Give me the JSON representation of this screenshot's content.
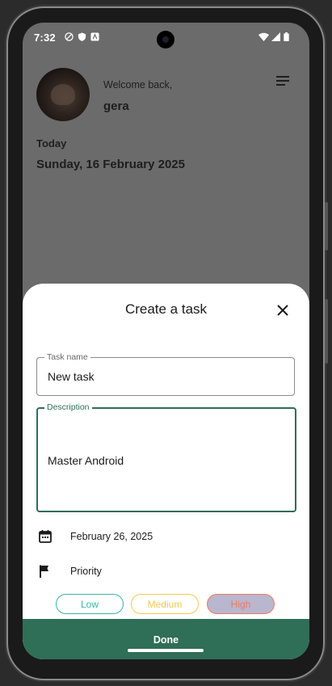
{
  "status_bar": {
    "time": "7:32"
  },
  "header": {
    "welcome": "Welcome back,",
    "username": "gera",
    "today_label": "Today",
    "full_date": "Sunday, 16 February 2025"
  },
  "sheet": {
    "title": "Create a task",
    "task_name": {
      "label": "Task name",
      "value": "New task"
    },
    "description": {
      "label": "Description",
      "value": "Master Android"
    },
    "due_date": "February 26, 2025",
    "priority_label": "Priority",
    "priorities": [
      {
        "label": "Low",
        "color": "#3fb3a4"
      },
      {
        "label": "Medium",
        "color": "#f2c94c"
      },
      {
        "label": "High",
        "color": "#f07a5a",
        "selected": true
      }
    ],
    "done_label": "Done"
  },
  "colors": {
    "accent": "#2f6e57",
    "overlay": "#6b6b6b",
    "selected_chip_bg": "#b8b7cf"
  }
}
